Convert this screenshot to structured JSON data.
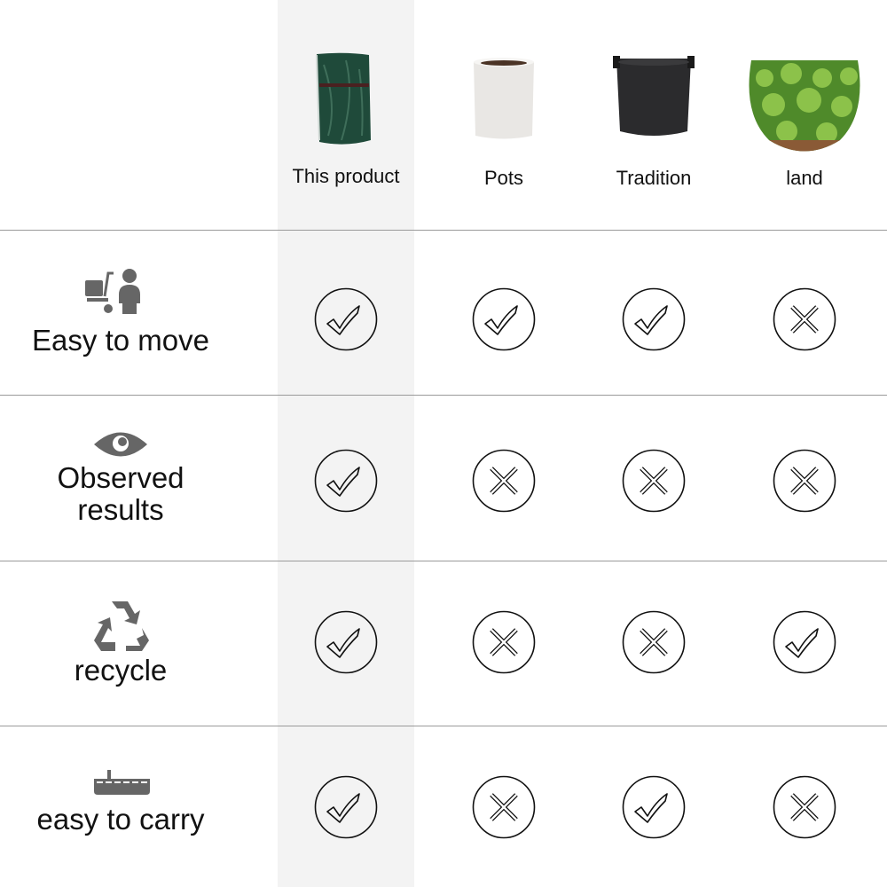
{
  "columns": [
    {
      "label": "This product",
      "image": "green-grow-bag"
    },
    {
      "label": "Pots",
      "image": "white-pot"
    },
    {
      "label": "Tradition",
      "image": "black-fabric-bag"
    },
    {
      "label": "land",
      "image": "potato-field"
    }
  ],
  "rows": [
    {
      "label": "Easy to move",
      "icon": "cart-person-icon",
      "values": [
        "check",
        "check",
        "check",
        "cross"
      ]
    },
    {
      "label": "Observed results",
      "label_lines": [
        "Observed",
        "results"
      ],
      "icon": "eye-icon",
      "values": [
        "check",
        "cross",
        "cross",
        "cross"
      ]
    },
    {
      "label": "recycle",
      "icon": "recycle-icon",
      "values": [
        "check",
        "cross",
        "cross",
        "check"
      ]
    },
    {
      "label": "easy to carry",
      "icon": "tray-icon",
      "values": [
        "check",
        "cross",
        "check",
        "cross"
      ]
    }
  ],
  "colors": {
    "highlight_column": "#f3f3f3",
    "icon": "#666666",
    "divider": "#9a9a9a"
  }
}
